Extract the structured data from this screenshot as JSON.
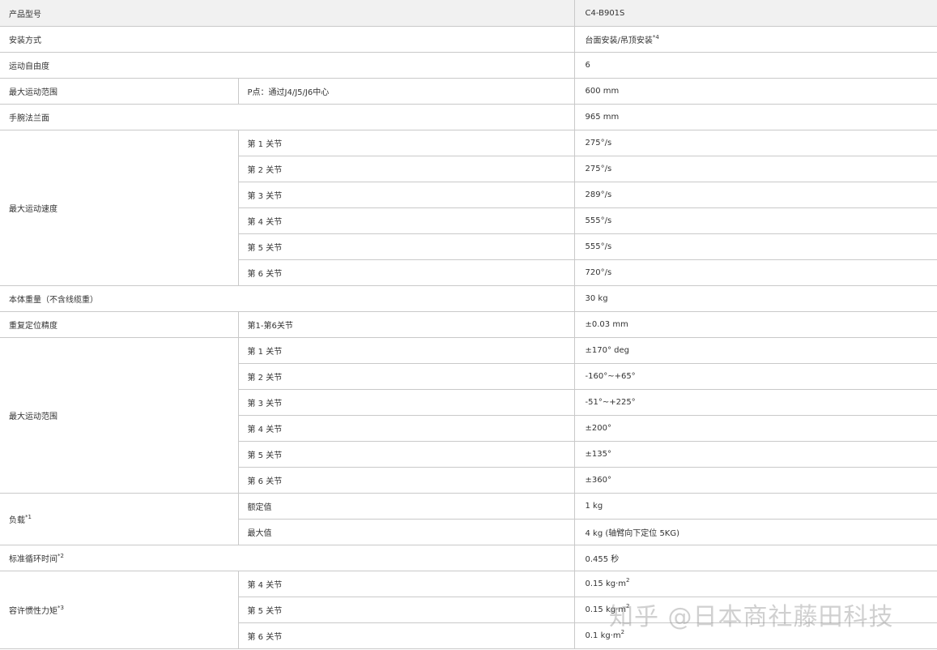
{
  "table": {
    "header": {
      "label": "产品型号",
      "value": "C4-B901S"
    },
    "mounting": {
      "label": "安装方式",
      "value": "台面安装/吊顶安装",
      "note": "*4"
    },
    "dof": {
      "label": "运动自由度",
      "value": "6"
    },
    "max_reach": {
      "label": "最大运动范围",
      "sub": "P点：通过J4/J5/J6中心",
      "value": "600 mm"
    },
    "wrist_flange": {
      "label": "手腕法兰面",
      "value": "965 mm"
    },
    "max_speed": {
      "label": "最大运动速度",
      "joints": [
        {
          "joint": "第 1 关节",
          "value": "275°/s"
        },
        {
          "joint": "第 2 关节",
          "value": "275°/s"
        },
        {
          "joint": "第 3 关节",
          "value": "289°/s"
        },
        {
          "joint": "第 4 关节",
          "value": "555°/s"
        },
        {
          "joint": "第 5 关节",
          "value": "555°/s"
        },
        {
          "joint": "第 6 关节",
          "value": "720°/s"
        }
      ]
    },
    "weight": {
      "label": "本体重量（不含线缆重）",
      "value": "30 kg"
    },
    "repeatability": {
      "label": "重复定位精度",
      "sub": "第1-第6关节",
      "value": "±0.03 mm"
    },
    "motion_range": {
      "label": "最大运动范围",
      "joints": [
        {
          "joint": "第 1 关节",
          "value": "±170° deg"
        },
        {
          "joint": "第 2 关节",
          "value": "-160°~+65°"
        },
        {
          "joint": "第 3 关节",
          "value": "-51°~+225°"
        },
        {
          "joint": "第 4 关节",
          "value": "±200°"
        },
        {
          "joint": "第 5 关节",
          "value": "±135°"
        },
        {
          "joint": "第 6 关节",
          "value": "±360°"
        }
      ]
    },
    "payload": {
      "label": "负载",
      "note": "*1",
      "rated": {
        "label": "额定值",
        "value": "1 kg"
      },
      "max": {
        "label": "最大值",
        "value": "4 kg (轴臂向下定位 5KG)"
      }
    },
    "cycle_time": {
      "label": "标准循环时间",
      "note": "*2",
      "value": "0.455 秒"
    },
    "inertia": {
      "label": "容许惯性力矩",
      "note": "*3",
      "joints": [
        {
          "joint": "第 4 关节",
          "value": "0.15 kg·m",
          "exp": "2"
        },
        {
          "joint": "第 5 关节",
          "value": "0.15 kg·m",
          "exp": "2"
        },
        {
          "joint": "第 6 关节",
          "value": "0.1 kg·m",
          "exp": "2"
        }
      ]
    }
  },
  "watermark": {
    "text": "知乎 @日本商社藤田科技"
  }
}
